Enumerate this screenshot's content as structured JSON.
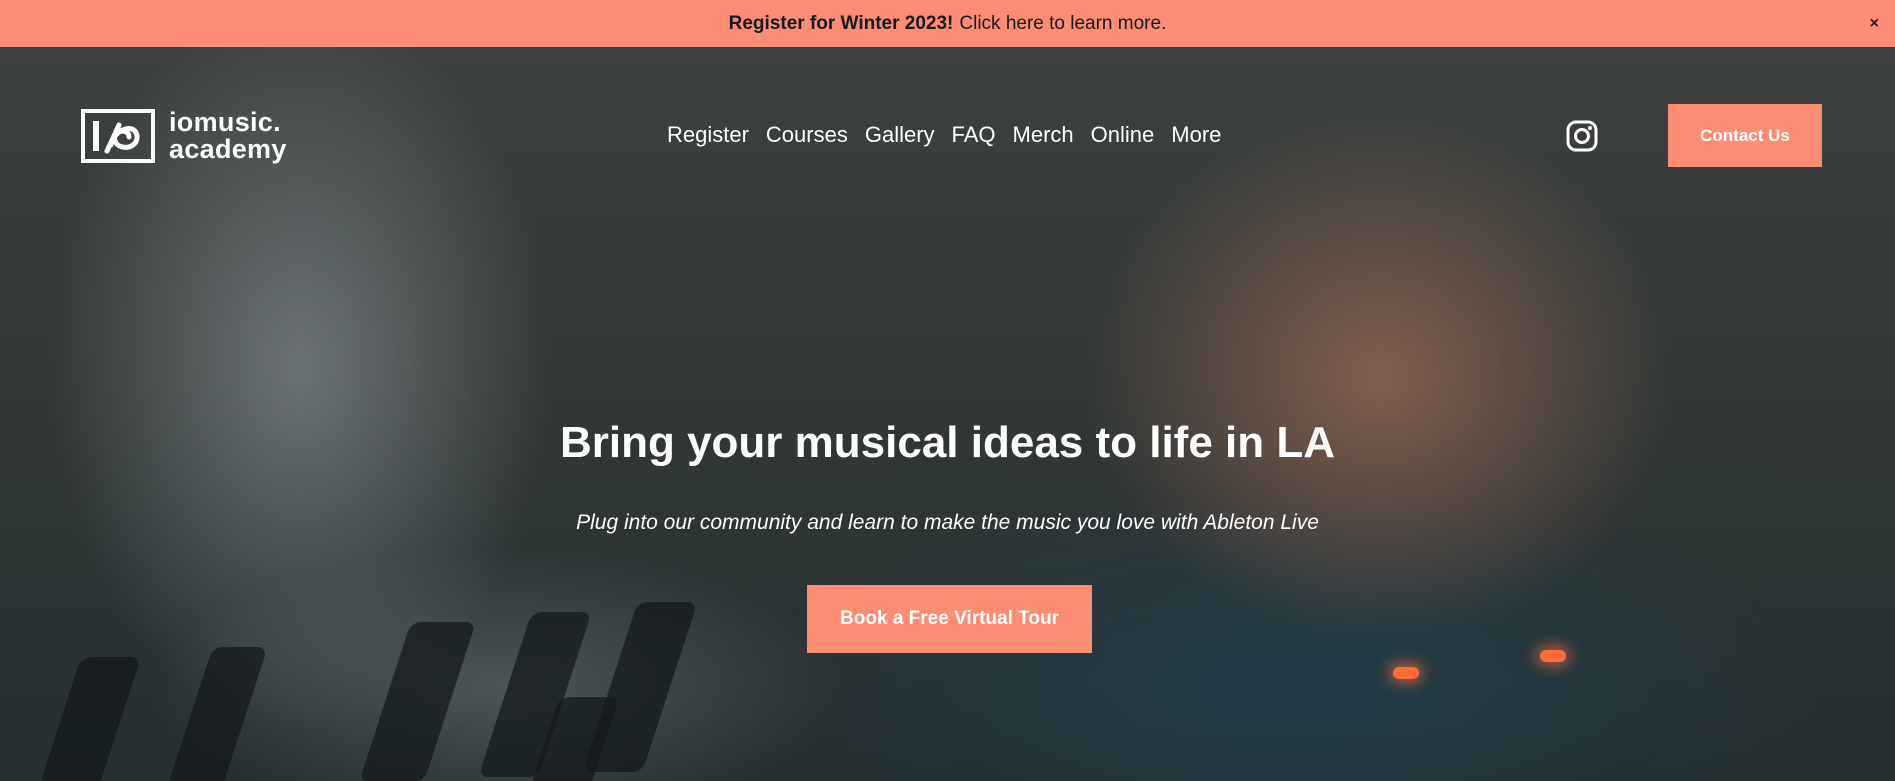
{
  "announcement": {
    "strong": "Register for Winter 2023!",
    "text": "Click here to learn more.",
    "close_symbol": "×"
  },
  "brand": {
    "line1": "iomusic.",
    "line2": "academy",
    "logo_icon": "io-logo-icon"
  },
  "nav": [
    "Register",
    "Courses",
    "Gallery",
    "FAQ",
    "Merch",
    "Online",
    "More"
  ],
  "social": {
    "icon": "instagram-icon"
  },
  "contact_button": "Contact Us",
  "hero": {
    "headline": "Bring your musical ideas to life in LA",
    "subhead": "Plug into our community and learn to make the music you love with Ableton Live",
    "cta": "Book a Free Virtual Tour"
  },
  "colors": {
    "accent": "#fb8d74",
    "text_on_dark": "#ffffff"
  }
}
